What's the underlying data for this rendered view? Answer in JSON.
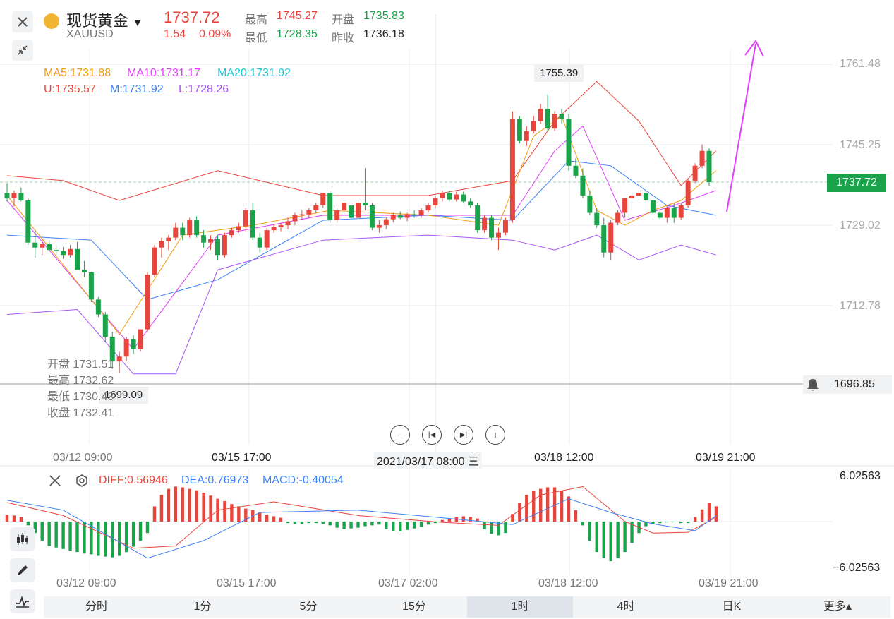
{
  "header": {
    "name": "现货黄金",
    "symbol": "XAUUSD",
    "price": "1737.72",
    "change": "1.54",
    "change_pct": "0.09%",
    "high_label": "最高",
    "high": "1745.27",
    "open_label": "开盘",
    "open": "1735.83",
    "low_label": "最低",
    "low": "1728.35",
    "prev_label": "昨收",
    "prev": "1736.18"
  },
  "indicators": {
    "ma5": "MA5:1731.88",
    "ma10": "MA10:1731.17",
    "ma20": "MA20:1731.92",
    "u": "U:1735.57",
    "m": "M:1731.92",
    "l": "L:1728.26"
  },
  "ohlc_tip": {
    "open": "开盘 1731.51",
    "high": "最高 1732.62",
    "low": "最低 1730.43",
    "close": "收盘 1732.41"
  },
  "marks": {
    "max": "1755.39",
    "min": "1699.09",
    "current_price": "1737.72",
    "alert_price": "1696.85"
  },
  "macd_labels": {
    "diff": "DIFF:0.56946",
    "dea": "DEA:0.76973",
    "macd": "MACD:-0.40054",
    "top": "6.02563",
    "bottom": "−6.02563"
  },
  "time_labels": {
    "t0": "03/12 09:00",
    "t1": "03/15 17:00",
    "t2": "2021/03/17 08:00 三",
    "t3": "03/18 12:00",
    "t4": "03/19 21:00"
  },
  "macd_time_labels": {
    "t0": "03/12 09:00",
    "t1": "03/15 17:00",
    "t2": "03/17 02:00",
    "t3": "03/18 12:00",
    "t4": "03/19 21:00"
  },
  "tabs": [
    "分时",
    "1分",
    "5分",
    "15分",
    "1时",
    "4时",
    "日K",
    "更多▴"
  ],
  "colors": {
    "up": "#e8453c",
    "down": "#1aa34a",
    "ma5": "#f39c12",
    "ma10": "#e040fb",
    "ma20": "#1ec8d8",
    "boll_u": "#e8453c",
    "boll_m": "#3b82f6",
    "boll_l": "#a855f7",
    "arrow": "#e040fb"
  },
  "chart_data": {
    "type": "candlestick",
    "y_ticks": [
      1761.48,
      1745.25,
      1729.02,
      1712.78
    ],
    "ylim": [
      1696.85,
      1765.0
    ],
    "candles": [
      [
        1735.5,
        1737.5,
        1733.8,
        1734.5
      ],
      [
        1734.5,
        1736.0,
        1732.8,
        1735.5
      ],
      [
        1735.5,
        1736.6,
        1733.8,
        1734.0
      ],
      [
        1734.0,
        1734.6,
        1725.0,
        1725.5
      ],
      [
        1725.5,
        1728.0,
        1722.5,
        1724.5
      ],
      [
        1724.5,
        1726.2,
        1723.0,
        1725.2
      ],
      [
        1725.2,
        1726.0,
        1723.8,
        1724.0
      ],
      [
        1724.0,
        1725.0,
        1723.0,
        1723.8
      ],
      [
        1723.8,
        1724.6,
        1722.2,
        1723.0
      ],
      [
        1723.0,
        1725.0,
        1722.5,
        1724.2
      ],
      [
        1724.2,
        1725.6,
        1721.0,
        1720.0
      ],
      [
        1720.0,
        1721.8,
        1718.5,
        1719.5
      ],
      [
        1719.5,
        1719.5,
        1713.5,
        1714.0
      ],
      [
        1714.0,
        1714.5,
        1710.5,
        1711.0
      ],
      [
        1711.0,
        1711.5,
        1705.5,
        1706.5
      ],
      [
        1706.5,
        1707.5,
        1700.0,
        1701.5
      ],
      [
        1701.5,
        1703.5,
        1699.1,
        1702.5
      ],
      [
        1702.5,
        1706.5,
        1701.5,
        1706.0
      ],
      [
        1706.0,
        1706.8,
        1703.0,
        1704.0
      ],
      [
        1704.0,
        1708.0,
        1703.5,
        1708.0
      ],
      [
        1708.0,
        1719.5,
        1707.5,
        1719.0
      ],
      [
        1719.0,
        1725.0,
        1718.5,
        1724.5
      ],
      [
        1724.5,
        1726.5,
        1722.5,
        1725.8
      ],
      [
        1725.8,
        1727.0,
        1724.0,
        1726.5
      ],
      [
        1726.5,
        1729.5,
        1726.0,
        1728.5
      ],
      [
        1728.5,
        1729.5,
        1726.0,
        1727.0
      ],
      [
        1727.0,
        1730.5,
        1726.5,
        1730.0
      ],
      [
        1730.0,
        1730.8,
        1726.5,
        1727.0
      ],
      [
        1727.0,
        1728.0,
        1724.5,
        1725.5
      ],
      [
        1725.5,
        1727.0,
        1724.0,
        1726.2
      ],
      [
        1726.2,
        1727.0,
        1722.0,
        1723.0
      ],
      [
        1723.0,
        1727.5,
        1722.5,
        1727.0
      ],
      [
        1727.0,
        1728.5,
        1726.5,
        1728.0
      ],
      [
        1728.0,
        1729.5,
        1727.5,
        1728.8
      ],
      [
        1728.8,
        1732.5,
        1728.0,
        1732.0
      ],
      [
        1732.0,
        1733.5,
        1726.0,
        1726.5
      ],
      [
        1726.5,
        1727.5,
        1723.5,
        1724.5
      ],
      [
        1724.5,
        1728.5,
        1724.0,
        1728.0
      ],
      [
        1728.0,
        1729.2,
        1727.5,
        1728.6
      ],
      [
        1728.6,
        1729.5,
        1727.8,
        1729.0
      ],
      [
        1729.0,
        1730.5,
        1728.2,
        1729.8
      ],
      [
        1729.8,
        1731.5,
        1729.0,
        1731.0
      ],
      [
        1731.0,
        1732.0,
        1730.2,
        1731.2
      ],
      [
        1731.2,
        1732.5,
        1730.5,
        1732.0
      ],
      [
        1732.0,
        1733.5,
        1731.5,
        1733.0
      ],
      [
        1733.0,
        1735.5,
        1732.5,
        1735.5
      ],
      [
        1735.5,
        1736.0,
        1729.5,
        1730.0
      ],
      [
        1730.0,
        1732.5,
        1729.5,
        1732.0
      ],
      [
        1732.0,
        1734.0,
        1731.0,
        1733.5
      ],
      [
        1733.0,
        1733.5,
        1730.0,
        1730.5
      ],
      [
        1730.5,
        1734.0,
        1730.0,
        1733.5
      ],
      [
        1733.5,
        1740.5,
        1732.0,
        1733.0
      ],
      [
        1733.0,
        1733.5,
        1728.0,
        1728.5
      ],
      [
        1728.5,
        1730.0,
        1727.5,
        1729.0
      ],
      [
        1729.0,
        1730.5,
        1728.2,
        1730.2
      ],
      [
        1730.2,
        1731.5,
        1729.6,
        1731.0
      ],
      [
        1731.0,
        1731.8,
        1730.2,
        1730.5
      ],
      [
        1730.5,
        1731.5,
        1729.8,
        1731.2
      ],
      [
        1731.2,
        1732.0,
        1730.5,
        1731.0
      ],
      [
        1731.0,
        1732.5,
        1730.5,
        1732.0
      ],
      [
        1732.0,
        1733.5,
        1731.5,
        1733.0
      ],
      [
        1733.0,
        1735.0,
        1732.5,
        1734.5
      ],
      [
        1734.5,
        1736.0,
        1733.8,
        1735.5
      ],
      [
        1735.5,
        1736.0,
        1733.8,
        1734.2
      ],
      [
        1734.2,
        1735.8,
        1733.8,
        1735.2
      ],
      [
        1735.2,
        1735.8,
        1733.5,
        1733.8
      ],
      [
        1733.8,
        1734.5,
        1732.5,
        1733.0
      ],
      [
        1733.0,
        1733.5,
        1727.5,
        1728.0
      ],
      [
        1728.0,
        1731.0,
        1727.5,
        1730.5
      ],
      [
        1730.5,
        1731.0,
        1726.0,
        1726.5
      ],
      [
        1726.5,
        1728.5,
        1724.0,
        1727.5
      ],
      [
        1727.5,
        1730.5,
        1727.0,
        1730.0
      ],
      [
        1730.0,
        1752.0,
        1729.5,
        1750.5
      ],
      [
        1750.5,
        1751.0,
        1745.5,
        1746.0
      ],
      [
        1746.0,
        1749.0,
        1745.0,
        1748.0
      ],
      [
        1748.0,
        1751.0,
        1747.5,
        1750.0
      ],
      [
        1750.0,
        1753.5,
        1749.5,
        1752.5
      ],
      [
        1752.5,
        1755.4,
        1748.0,
        1748.5
      ],
      [
        1748.5,
        1752.0,
        1748.0,
        1751.5
      ],
      [
        1751.5,
        1752.5,
        1749.5,
        1750.5
      ],
      [
        1750.5,
        1751.5,
        1740.0,
        1741.0
      ],
      [
        1741.0,
        1742.5,
        1738.5,
        1739.0
      ],
      [
        1739.0,
        1740.5,
        1734.5,
        1735.0
      ],
      [
        1735.0,
        1736.0,
        1731.0,
        1731.5
      ],
      [
        1731.5,
        1732.5,
        1728.5,
        1729.0
      ],
      [
        1729.0,
        1730.5,
        1722.5,
        1723.5
      ],
      [
        1723.5,
        1730.0,
        1722.0,
        1729.5
      ],
      [
        1729.5,
        1732.0,
        1729.0,
        1731.5
      ],
      [
        1731.5,
        1734.5,
        1730.5,
        1734.5
      ],
      [
        1734.5,
        1735.5,
        1733.5,
        1735.0
      ],
      [
        1735.0,
        1736.0,
        1734.0,
        1735.5
      ],
      [
        1735.5,
        1735.8,
        1733.5,
        1734.0
      ],
      [
        1734.0,
        1734.5,
        1731.0,
        1731.5
      ],
      [
        1731.5,
        1732.0,
        1730.0,
        1730.5
      ],
      [
        1730.5,
        1733.0,
        1729.5,
        1732.5
      ],
      [
        1732.5,
        1733.5,
        1729.5,
        1730.5
      ],
      [
        1730.5,
        1733.5,
        1730.0,
        1733.0
      ],
      [
        1733.0,
        1738.5,
        1732.5,
        1738.0
      ],
      [
        1738.0,
        1741.5,
        1737.5,
        1741.0
      ],
      [
        1741.0,
        1745.3,
        1740.5,
        1744.0
      ],
      [
        1744.0,
        1744.5,
        1737.0,
        1737.7
      ]
    ],
    "ma5": [
      [
        0,
        1735
      ],
      [
        16,
        1707
      ],
      [
        25,
        1727
      ],
      [
        35,
        1729
      ],
      [
        46,
        1732
      ],
      [
        60,
        1731
      ],
      [
        70,
        1729
      ],
      [
        75,
        1747
      ],
      [
        79,
        1751
      ],
      [
        84,
        1732
      ],
      [
        88,
        1729
      ],
      [
        92,
        1732
      ],
      [
        96,
        1734
      ],
      [
        101,
        1740
      ]
    ],
    "ma10": [
      [
        0,
        1734
      ],
      [
        18,
        1704
      ],
      [
        30,
        1727
      ],
      [
        45,
        1731
      ],
      [
        60,
        1731
      ],
      [
        72,
        1731
      ],
      [
        78,
        1744
      ],
      [
        82,
        1749
      ],
      [
        88,
        1730
      ],
      [
        95,
        1733
      ],
      [
        101,
        1736
      ]
    ],
    "boll_u": [
      [
        0,
        1739
      ],
      [
        8,
        1738
      ],
      [
        16,
        1734
      ],
      [
        30,
        1740
      ],
      [
        45,
        1735
      ],
      [
        60,
        1735
      ],
      [
        72,
        1738
      ],
      [
        78,
        1750
      ],
      [
        84,
        1758
      ],
      [
        90,
        1750
      ],
      [
        96,
        1737
      ],
      [
        101,
        1744
      ]
    ],
    "boll_m": [
      [
        0,
        1727
      ],
      [
        12,
        1726
      ],
      [
        20,
        1714
      ],
      [
        30,
        1718
      ],
      [
        45,
        1730
      ],
      [
        60,
        1731
      ],
      [
        72,
        1730
      ],
      [
        80,
        1742
      ],
      [
        86,
        1741
      ],
      [
        94,
        1733
      ],
      [
        101,
        1731
      ]
    ],
    "boll_l": [
      [
        0,
        1711
      ],
      [
        10,
        1712
      ],
      [
        18,
        1699
      ],
      [
        24,
        1699
      ],
      [
        30,
        1720
      ],
      [
        45,
        1726
      ],
      [
        60,
        1727
      ],
      [
        72,
        1726
      ],
      [
        78,
        1724
      ],
      [
        84,
        1727
      ],
      [
        90,
        1722
      ],
      [
        96,
        1725
      ],
      [
        101,
        1723
      ]
    ],
    "macd": {
      "ylim": [
        -6.02563,
        6.02563
      ],
      "bars": [
        0.9,
        0.8,
        0.6,
        -0.5,
        -1.5,
        -2.5,
        -3.2,
        -3.4,
        -3.6,
        -3.8,
        -4.0,
        -4.2,
        -4.3,
        -4.5,
        -4.6,
        -4.7,
        -4.5,
        -4.0,
        -3.3,
        -2.5,
        -1.5,
        2.0,
        3.5,
        4.3,
        4.6,
        4.5,
        4.3,
        4.1,
        3.8,
        3.4,
        3.0,
        2.7,
        2.3,
        2.0,
        1.7,
        1.5,
        1.2,
        0.9,
        0.7,
        0.5,
        -0.2,
        -0.3,
        -0.3,
        -0.2,
        -0.2,
        -0.3,
        -0.5,
        -0.8,
        -1.0,
        -0.9,
        -0.8,
        -0.6,
        -0.5,
        -0.4,
        -1.0,
        -1.2,
        -1.3,
        -1.1,
        -0.9,
        -0.7,
        -0.4,
        -0.2,
        0.2,
        0.4,
        0.6,
        0.7,
        0.6,
        0.4,
        -1.0,
        -1.6,
        -1.8,
        -1.5,
        1.0,
        2.5,
        3.5,
        4.0,
        4.3,
        4.5,
        4.5,
        4.0,
        3.3,
        1.5,
        -0.5,
        -2.5,
        -4.0,
        -4.8,
        -5.2,
        -4.8,
        -4.0,
        -2.8,
        -1.5,
        -0.6,
        -0.3,
        -0.2,
        -0.1,
        -0.1,
        -0.2,
        -0.2,
        0.6,
        1.6,
        2.5,
        2.0
      ],
      "diff": [
        [
          0,
          2.5
        ],
        [
          8,
          0.8
        ],
        [
          18,
          -3.5
        ],
        [
          24,
          -3.2
        ],
        [
          30,
          1.5
        ],
        [
          38,
          2.6
        ],
        [
          50,
          0.8
        ],
        [
          62,
          -0.1
        ],
        [
          70,
          -0.5
        ],
        [
          76,
          3.5
        ],
        [
          82,
          4.6
        ],
        [
          88,
          0
        ],
        [
          92,
          -1.5
        ],
        [
          97,
          -1.4
        ],
        [
          101,
          0.57
        ]
      ],
      "dea": [
        [
          0,
          2.8
        ],
        [
          8,
          1.5
        ],
        [
          20,
          -4.8
        ],
        [
          28,
          -2.5
        ],
        [
          36,
          1.2
        ],
        [
          50,
          1.5
        ],
        [
          62,
          0.5
        ],
        [
          72,
          -0.4
        ],
        [
          80,
          3.0
        ],
        [
          86,
          1.2
        ],
        [
          92,
          -0.3
        ],
        [
          98,
          -1.2
        ],
        [
          101,
          0.77
        ]
      ]
    }
  }
}
